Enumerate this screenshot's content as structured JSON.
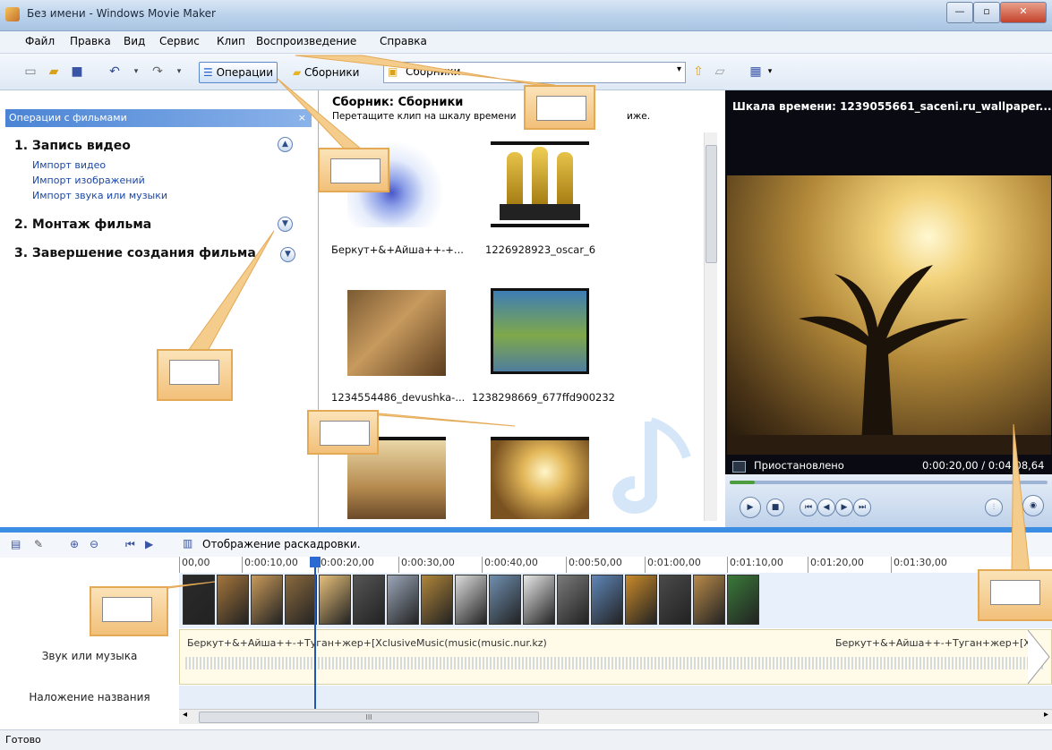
{
  "window": {
    "title": "Без имени - Windows Movie Maker"
  },
  "menu": [
    "Файл",
    "Правка",
    "Вид",
    "Сервис",
    "Клип",
    "Воспроизведение",
    "Справка"
  ],
  "toolbar": {
    "operations_label": "Операции",
    "collections_label": "Сборники",
    "collection_combo_value": "Сборники"
  },
  "tasks": {
    "header": "Операции с фильмами",
    "close_glyph": "×",
    "sections": [
      {
        "title": "1. Запись видео",
        "expanded": true,
        "links": [
          "Импорт видео",
          "Импорт изображений",
          "Импорт звука или музыки"
        ]
      },
      {
        "title": "2. Монтаж фильма",
        "expanded": false,
        "links": []
      },
      {
        "title": "3. Завершение создания фильма",
        "expanded": false,
        "links": []
      }
    ]
  },
  "collection": {
    "title": "Сборник: Сборники",
    "hint": "Перетащите клип на шкалу времени",
    "hint_tail": "иже.",
    "items": [
      {
        "caption": "Беркут+&+Айша++-+..."
      },
      {
        "caption": "1226928923_oscar_6"
      },
      {
        "caption": "1234554486_devushka-..."
      },
      {
        "caption": "1238298669_677ffd900232"
      },
      {
        "caption": ""
      },
      {
        "caption": ""
      }
    ]
  },
  "preview": {
    "title": "Шкала времени: 1239055661_saceni.ru_wallpaper...",
    "status": "Приостановлено",
    "time": "0:00:20,00 / 0:04:08,64",
    "progress_fraction": 0.08
  },
  "timeline": {
    "storyboard_label": "Отображение раскадровки.",
    "ruler": [
      "00,00",
      "0:00:10,00",
      "0:00:20,00",
      "0:00:30,00",
      "0:00:40,00",
      "0:00:50,00",
      "0:01:00,00",
      "0:01:10,00",
      "0:01:20,00",
      "0:01:30,00"
    ],
    "audio_label": "Звук или музыка",
    "title_overlay_label": "Наложение названия",
    "audio_clip_1": "Беркут+&+Айша++-+Туган+жер+[XclusiveMusic(music(music.nur.kz)",
    "audio_clip_2": "Беркут+&+Айша++-+Туган+жер+[Xc",
    "scroll_glyph": "III"
  },
  "status": {
    "text": "Готово"
  },
  "icons": {
    "new": "new-file-icon",
    "open": "open-folder-icon",
    "save": "save-icon",
    "undo": "undo-icon",
    "redo": "redo-icon",
    "views": "view-options-icon"
  }
}
